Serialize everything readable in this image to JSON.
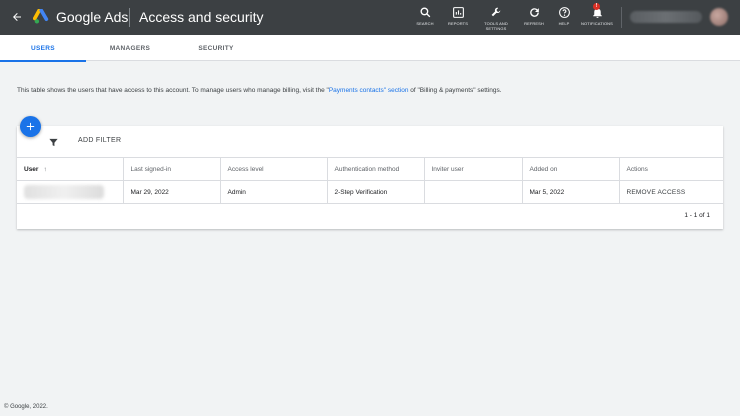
{
  "header": {
    "product_name": "Google Ads",
    "page_title": "Access and security",
    "tools": [
      {
        "label": "SEARCH",
        "icon": "search-icon"
      },
      {
        "label": "REPORTS",
        "icon": "reports-icon"
      },
      {
        "label": "TOOLS AND SETTINGS",
        "icon": "wrench-icon"
      },
      {
        "label": "REFRESH",
        "icon": "refresh-icon"
      },
      {
        "label": "HELP",
        "icon": "help-icon"
      },
      {
        "label": "NOTIFICATIONS",
        "icon": "bell-icon"
      }
    ],
    "notification_badge": "!"
  },
  "tabs": [
    {
      "label": "USERS",
      "active": true
    },
    {
      "label": "MANAGERS",
      "active": false
    },
    {
      "label": "SECURITY",
      "active": false
    }
  ],
  "info": {
    "prefix": "This table shows the users that have access to this account. To manage users who manage billing, visit the \"",
    "link": "Payments contacts\" section",
    "suffix": " of \"Billing & payments\" settings."
  },
  "toolbar": {
    "add_filter_label": "ADD FILTER"
  },
  "table": {
    "columns": [
      "User",
      "Last signed-in",
      "Access level",
      "Authentication method",
      "Inviter user",
      "Added on",
      "Actions"
    ],
    "rows": [
      {
        "user": "",
        "last_signed_in": "Mar 29, 2022",
        "access_level": "Admin",
        "auth_method": "2-Step Verification",
        "inviter": "",
        "added_on": "Mar 5, 2022",
        "action": "REMOVE ACCESS"
      }
    ],
    "pagination": "1 - 1 of 1"
  },
  "footer": "© Google, 2022.",
  "colors": {
    "header_bg": "#3c4043",
    "accent": "#1a73e8",
    "page_bg": "#f1f3f4",
    "badge": "#d93025"
  }
}
